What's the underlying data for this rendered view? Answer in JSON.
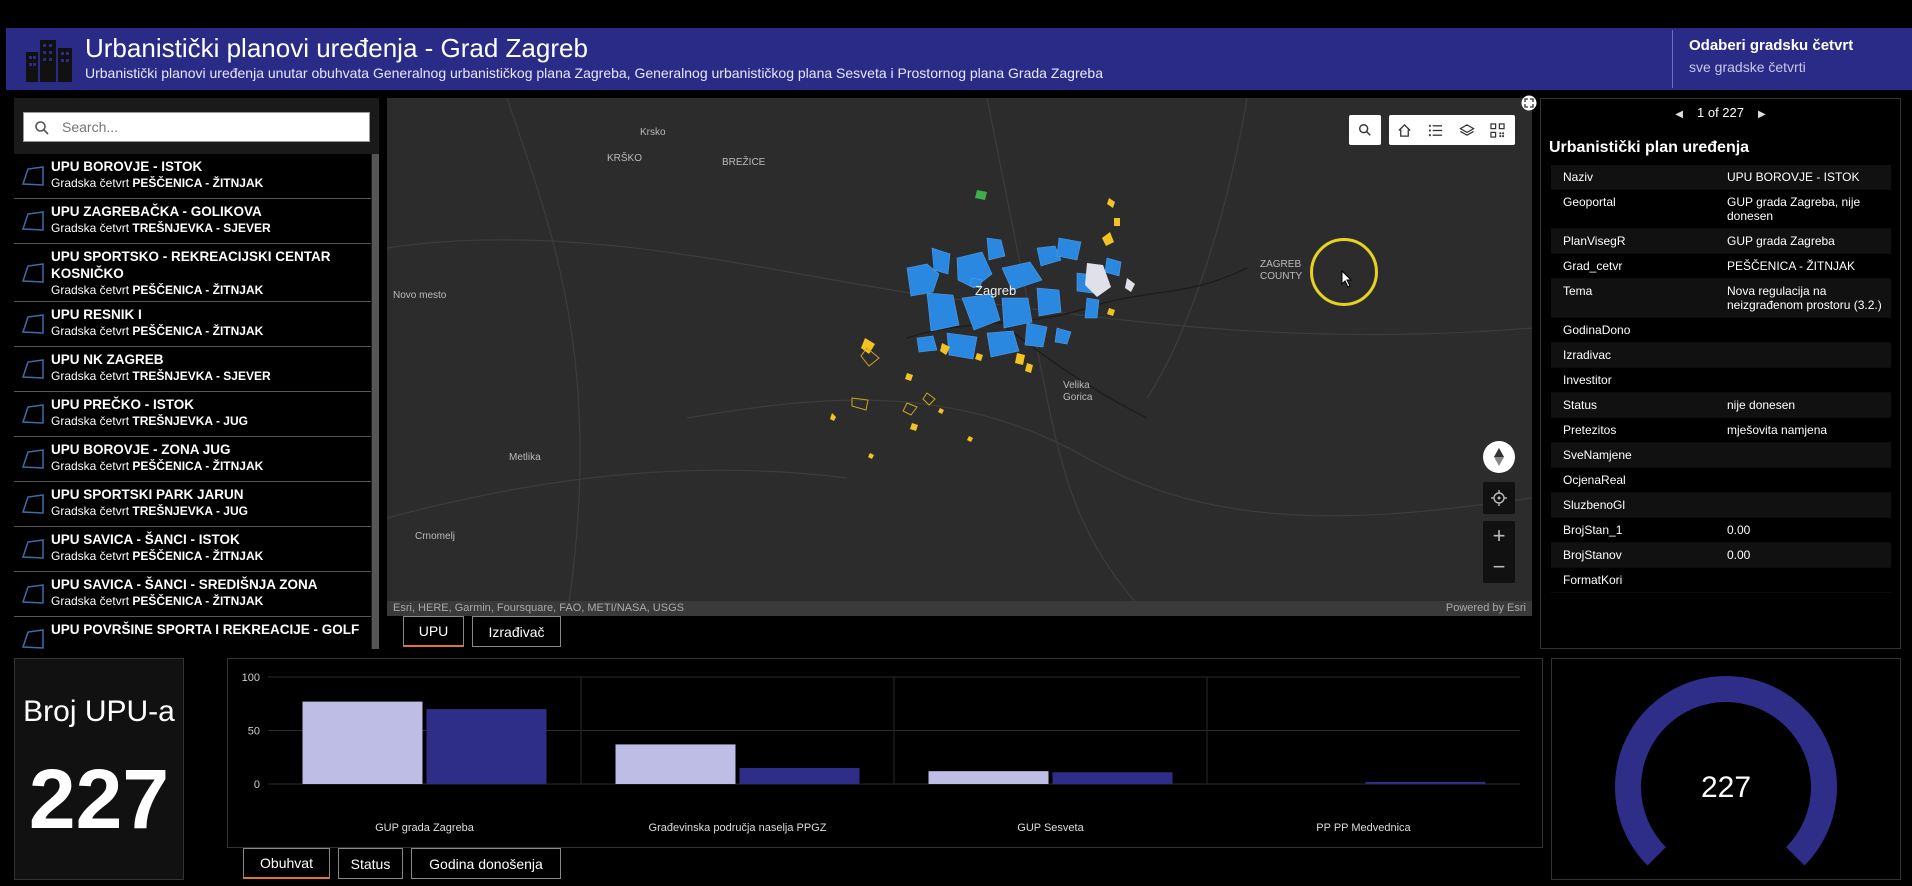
{
  "header": {
    "title": "Urbanistički planovi uređenja - Grad Zagreb",
    "subtitle": "Urbanistički planovi uređenja unutar obuhvata Generalnog urbanističkog plana Zagreba, Generalnog urbanističkog plana Sesveta i Prostornog plana Grada Zagreba",
    "selector_label": "Odaberi gradsku četvrt",
    "selector_value": "sve gradske četvrti",
    "accent": "#2a2a87"
  },
  "search": {
    "placeholder": "Search..."
  },
  "list": {
    "prefix": "Gradska četvrt",
    "items": [
      {
        "title": "UPU BOROVJE - ISTOK",
        "district": "PEŠČENICA - ŽITNJAK"
      },
      {
        "title": "UPU ZAGREBAČKA - GOLIKOVA",
        "district": "TREŠNJEVKA - SJEVER"
      },
      {
        "title": "UPU SPORTSKO - REKREACIJSKI CENTAR KOSNIČKO",
        "district": "PEŠČENICA - ŽITNJAK"
      },
      {
        "title": "UPU RESNIK I",
        "district": "PEŠČENICA - ŽITNJAK"
      },
      {
        "title": "UPU NK ZAGREB",
        "district": "TREŠNJEVKA - SJEVER"
      },
      {
        "title": "UPU PREČKO - ISTOK",
        "district": "TREŠNJEVKA - JUG"
      },
      {
        "title": "UPU BOROVJE - ZONA JUG",
        "district": "PEŠČENICA - ŽITNJAK"
      },
      {
        "title": "UPU SPORTSKI PARK JARUN",
        "district": "TREŠNJEVKA - JUG"
      },
      {
        "title": "UPU SAVICA - ŠANCI - ISTOK",
        "district": "PEŠČENICA - ŽITNJAK"
      },
      {
        "title": "UPU SAVICA - ŠANCI - SREDIŠNJA ZONA",
        "district": "PEŠČENICA - ŽITNJAK"
      },
      {
        "title": "UPU POVRŠINE SPORTA I REKREACIJE - GOLF",
        "district": ""
      }
    ]
  },
  "map": {
    "labels": {
      "krsko_town": "Krsko",
      "krsko_region": "KRŠKO",
      "brezice": "BREŽICE",
      "novo_mesto": "Novo mesto",
      "zagreb": "Zagreb",
      "zagreb_county": "ZAGREB COUNTY",
      "velika_gorica": "Velika Gorica",
      "metlika": "Metlika",
      "crnomelj": "Crnomelj"
    },
    "attribution": "Esri, HERE, Garmin, Foursquare, FAO, METI/NASA, USGS",
    "powered_by": "Powered by Esri",
    "tools": [
      "search-icon",
      "home-icon",
      "legend-list-icon",
      "layers-icon",
      "qr-code-icon"
    ],
    "zoom_in": "+",
    "zoom_out": "−",
    "tabs": [
      "UPU",
      "Izrađivač"
    ]
  },
  "details": {
    "pager": "1 of 227",
    "title": "Urbanistički plan uređenja",
    "rows": [
      {
        "k": "Naziv",
        "v": "UPU BOROVJE - ISTOK"
      },
      {
        "k": "Geoportal",
        "v": "GUP grada Zagreba, nije donesen"
      },
      {
        "k": "PlanVisegR",
        "v": "GUP grada Zagreba"
      },
      {
        "k": "Grad_cetvr",
        "v": "PEŠČENICA - ŽITNJAK"
      },
      {
        "k": "Tema",
        "v": "Nova regulacija na neizgrađenom prostoru (3.2.)"
      },
      {
        "k": "GodinaDono",
        "v": ""
      },
      {
        "k": "Izradivac",
        "v": ""
      },
      {
        "k": "Investitor",
        "v": ""
      },
      {
        "k": "Status",
        "v": "nije donesen"
      },
      {
        "k": "Pretezitos",
        "v": "mješovita namjena"
      },
      {
        "k": "SveNamjene",
        "v": ""
      },
      {
        "k": "OcjenaReal",
        "v": ""
      },
      {
        "k": "SluzbenoGl",
        "v": ""
      },
      {
        "k": "BrojStan_1",
        "v": "0.00"
      },
      {
        "k": "BrojStanov",
        "v": "0.00"
      },
      {
        "k": "FormatKori",
        "v": ""
      }
    ]
  },
  "kpi": {
    "label": "Broj UPU-a",
    "value": "227"
  },
  "chart_tabs": [
    "Obuhvat",
    "Status",
    "Godina donošenja"
  ],
  "chart_data": {
    "type": "bar",
    "categories": [
      "GUP grada Zagreba",
      "Građevinska područja naselja PPGZ",
      "GUP Sesveta",
      "PP PP Medvednica"
    ],
    "series": [
      {
        "color": "#bdbde6",
        "values": [
          77,
          37,
          12,
          0
        ]
      },
      {
        "color": "#2e2e88",
        "values": [
          70,
          15,
          11,
          2
        ]
      }
    ],
    "yticks": [
      0,
      50,
      100
    ],
    "ylim": [
      0,
      100
    ],
    "grid": true
  },
  "gauge": {
    "value": "227",
    "min": "0",
    "max": "227",
    "fraction": 1.0,
    "color": "#2e2e88"
  }
}
